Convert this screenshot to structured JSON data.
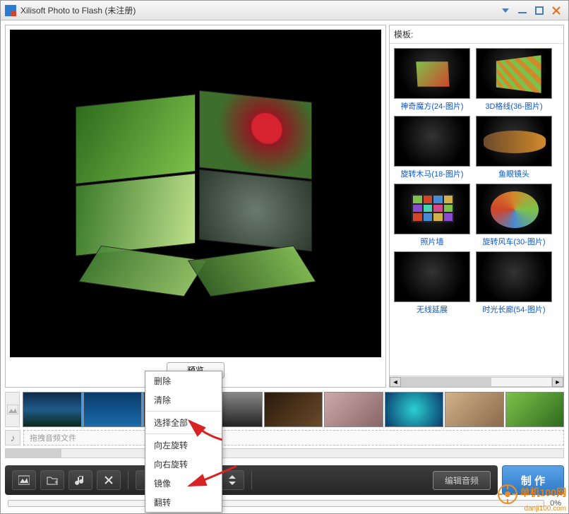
{
  "title": "Xilisoft Photo to Flash (未注册)",
  "side": {
    "header": "模板:",
    "templates": [
      {
        "label": "神奇魔方(24-图片)"
      },
      {
        "label": "3D格线(36-图片)"
      },
      {
        "label": "旋转木马(18-图片)"
      },
      {
        "label": "鱼眼镜头"
      },
      {
        "label": "照片墙"
      },
      {
        "label": "旋转风车(30-图片)"
      },
      {
        "label": "无线延展"
      },
      {
        "label": "时光长廊(54-图片)"
      }
    ]
  },
  "preview_button": "预览",
  "audio_placeholder": "拖拽音频文件",
  "context_menu": {
    "items": [
      "删除",
      "清除",
      "选择全部",
      "向左旋转",
      "向右旋转",
      "镜像",
      "翻转"
    ]
  },
  "toolbar": {
    "add_image": "add-image",
    "add_folder": "add-folder",
    "add_audio": "add-audio",
    "remove": "remove",
    "rotate_left": "rotate-left",
    "rotate_right": "rotate-right",
    "flip_h": "flip-h",
    "flip_v": "flip-v",
    "edit_audio": "编辑音频"
  },
  "make_button": "制 作",
  "progress": {
    "percent": "0%"
  },
  "watermark": {
    "brand": "单机100网",
    "url": "danji100.com"
  },
  "thumb_count": 9
}
